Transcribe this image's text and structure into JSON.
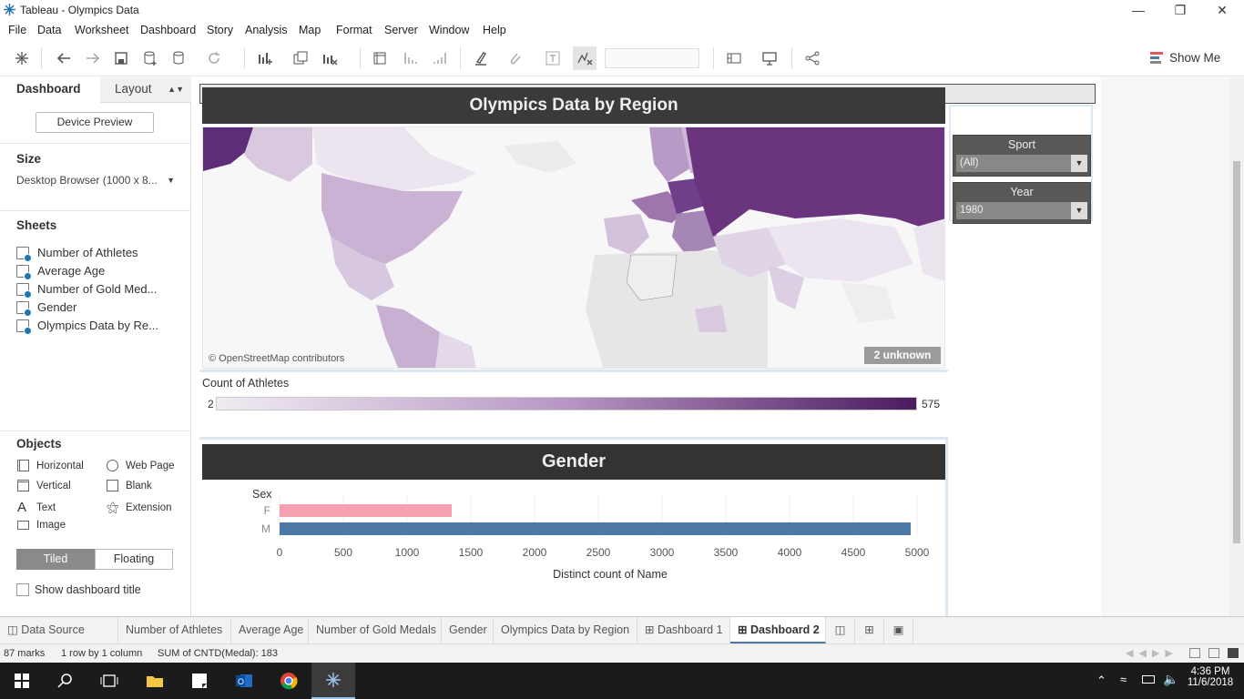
{
  "window": {
    "title": "Tableau - Olympics Data"
  },
  "menu": [
    "File",
    "Data",
    "Worksheet",
    "Dashboard",
    "Story",
    "Analysis",
    "Map",
    "Format",
    "Server",
    "Window",
    "Help"
  ],
  "toolbar": {
    "show_me": "Show Me"
  },
  "left_pane": {
    "tab_dashboard": "Dashboard",
    "tab_layout": "Layout",
    "device_preview": "Device Preview",
    "size_heading": "Size",
    "size_value": "Desktop Browser (1000 x 8...",
    "sheets_heading": "Sheets",
    "sheets": [
      "Number of Athletes",
      "Average Age",
      "Number of Gold Med...",
      "Gender",
      "Olympics Data by Re..."
    ],
    "objects_heading": "Objects",
    "objects": {
      "horizontal": "Horizontal",
      "web_page": "Web Page",
      "vertical": "Vertical",
      "blank": "Blank",
      "text": "Text",
      "extension": "Extension",
      "image": "Image"
    },
    "tiled": "Tiled",
    "floating": "Floating",
    "show_title": "Show dashboard title"
  },
  "dashboard": {
    "map_title": "Olympics Data by Region",
    "map_attribution": "© OpenStreetMap contributors",
    "map_unknown": "2 unknown",
    "legend_title": "Count of Athletes",
    "legend_min": "2",
    "legend_max": "575",
    "filters": [
      {
        "title": "Sport",
        "value": "(All)"
      },
      {
        "title": "Year",
        "value": "1980"
      }
    ]
  },
  "chart_data": {
    "type": "bar",
    "title": "Gender",
    "ylabel": "Sex",
    "xlabel": "Distinct count of Name",
    "categories": [
      "F",
      "M"
    ],
    "values": [
      1350,
      4950
    ],
    "colors": [
      "#f4a0b0",
      "#4e79a7"
    ],
    "xlim": [
      0,
      5000
    ],
    "xticks": [
      "0",
      "500",
      "1000",
      "1500",
      "2000",
      "2500",
      "3000",
      "3500",
      "4000",
      "4500",
      "5000"
    ]
  },
  "bottom_tabs": [
    "Data Source",
    "Number of Athletes",
    "Average Age",
    "Number of Gold Medals",
    "Gender",
    "Olympics Data by Region",
    "Dashboard 1",
    "Dashboard 2"
  ],
  "status": {
    "marks": "87 marks",
    "rows": "1 row by 1 column",
    "sum": "SUM of CNTD(Medal): 183"
  },
  "taskbar": {
    "time": "4:36 PM",
    "date": "11/6/2018"
  }
}
